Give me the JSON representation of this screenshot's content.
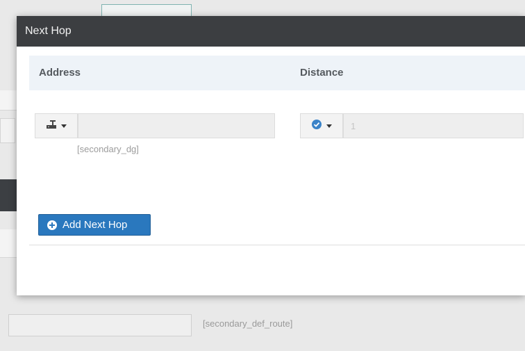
{
  "modal": {
    "title": "Next Hop",
    "columns": {
      "address": "Address",
      "distance": "Distance"
    },
    "address_field": {
      "icon": "network-device-icon",
      "value": "",
      "hint": "[secondary_dg]"
    },
    "distance_field": {
      "icon": "check-circle-icon",
      "value": "1"
    },
    "add_button": {
      "icon": "plus-circle-icon",
      "label": "Add Next Hop"
    }
  },
  "background": {
    "hint": "[secondary_def_route]"
  },
  "colors": {
    "header_bg": "#3c3e41",
    "table_head_bg": "#eef3f8",
    "primary_button": "#2a78be",
    "check_icon": "#3a83c8"
  }
}
